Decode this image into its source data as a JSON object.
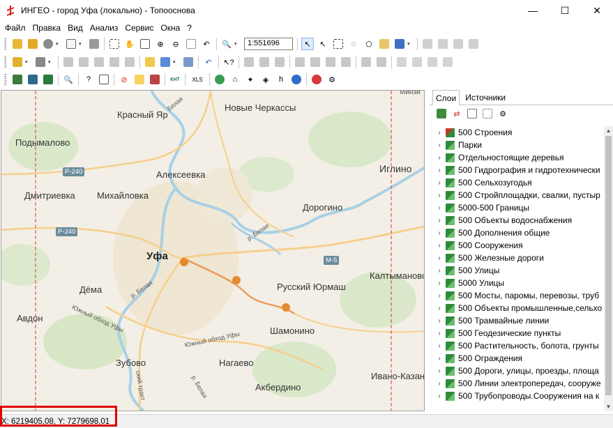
{
  "window": {
    "title": "ИНГЕО - город Уфа (локально) - Топооснова",
    "controls": {
      "minimize": "—",
      "maximize": "☐",
      "close": "✕"
    }
  },
  "menu": [
    "Файл",
    "Правка",
    "Вид",
    "Анализ",
    "Сервис",
    "Окна",
    "?"
  ],
  "toolbar": {
    "scale": "1:551696",
    "xls_label": "XLS",
    "knt_label": "КНТ"
  },
  "map": {
    "labels": {
      "krasny_yar": "Красный Яр",
      "novye_cherkassy": "Новые Черкассы",
      "podymalovo": "Подымалово",
      "iglino": "Иглино",
      "alekseevka": "Алексеевка",
      "dmitrievka": "Дмитриевка",
      "mikhailovka": "Михайловка",
      "dorogino": "Дорогино",
      "ufa": "Уфа",
      "kaltymanovo": "Калтыманово",
      "dema": "Дёма",
      "russky_yurmash": "Русский Юрмаш",
      "avdon": "Авдон",
      "shamonino": "Шамонино",
      "zubovo": "Зубово",
      "nagaevo": "Нагаево",
      "ivano_kazanka": "Ивано-Казанк",
      "akberdino": "Акбердино",
      "minzi": "Минзи",
      "yuzhny_obhod_1": "Южный обход Уфы",
      "yuzhny_obhod_2": "Южный обход Уфы",
      "belaya_1": "Белая",
      "belaya_2": "р. Белая",
      "belaya_3": "р. Белая",
      "belaya_4": "р. Белая",
      "trakt": "ский тракт"
    },
    "shields": {
      "r240_a": "Р-240",
      "r240_b": "Р-240",
      "m5": "М-5"
    }
  },
  "panel": {
    "tabs": [
      "Слои",
      "Источники"
    ],
    "layers": [
      "500 Строения",
      "Парки",
      "Отдельностоящие деревья",
      "500 Гидрография и гидротехнически",
      "500 Сельхозугодья",
      "500 Стройплощадки, свалки, пустыр",
      "5000-500 Границы",
      "500 Объекты водоснабжения",
      "500 Дополнения общие",
      "500 Сооружения",
      "500 Железные дороги",
      "500 Улицы",
      "5000 Улицы",
      "500 Мосты, паромы, перевозы, труб",
      "500 Объекты промышленные,сельхо",
      "500 Трамвайные линии",
      "500 Геодезические пункты",
      "500 Растительность, болота, грунты",
      "500 Ограждения",
      "500 Дороги, улицы, проезды, площа",
      "500 Линии электропередач, сооруже",
      "500 Трубопроводы.Сооружения на к"
    ]
  },
  "status": {
    "coords": "X: 6219405,08, Y: 7279698,01"
  },
  "colors": {
    "highlight": "#e00000",
    "river": "#a8d0e6",
    "road": "#f5b964",
    "route": "#ee9a5a"
  }
}
